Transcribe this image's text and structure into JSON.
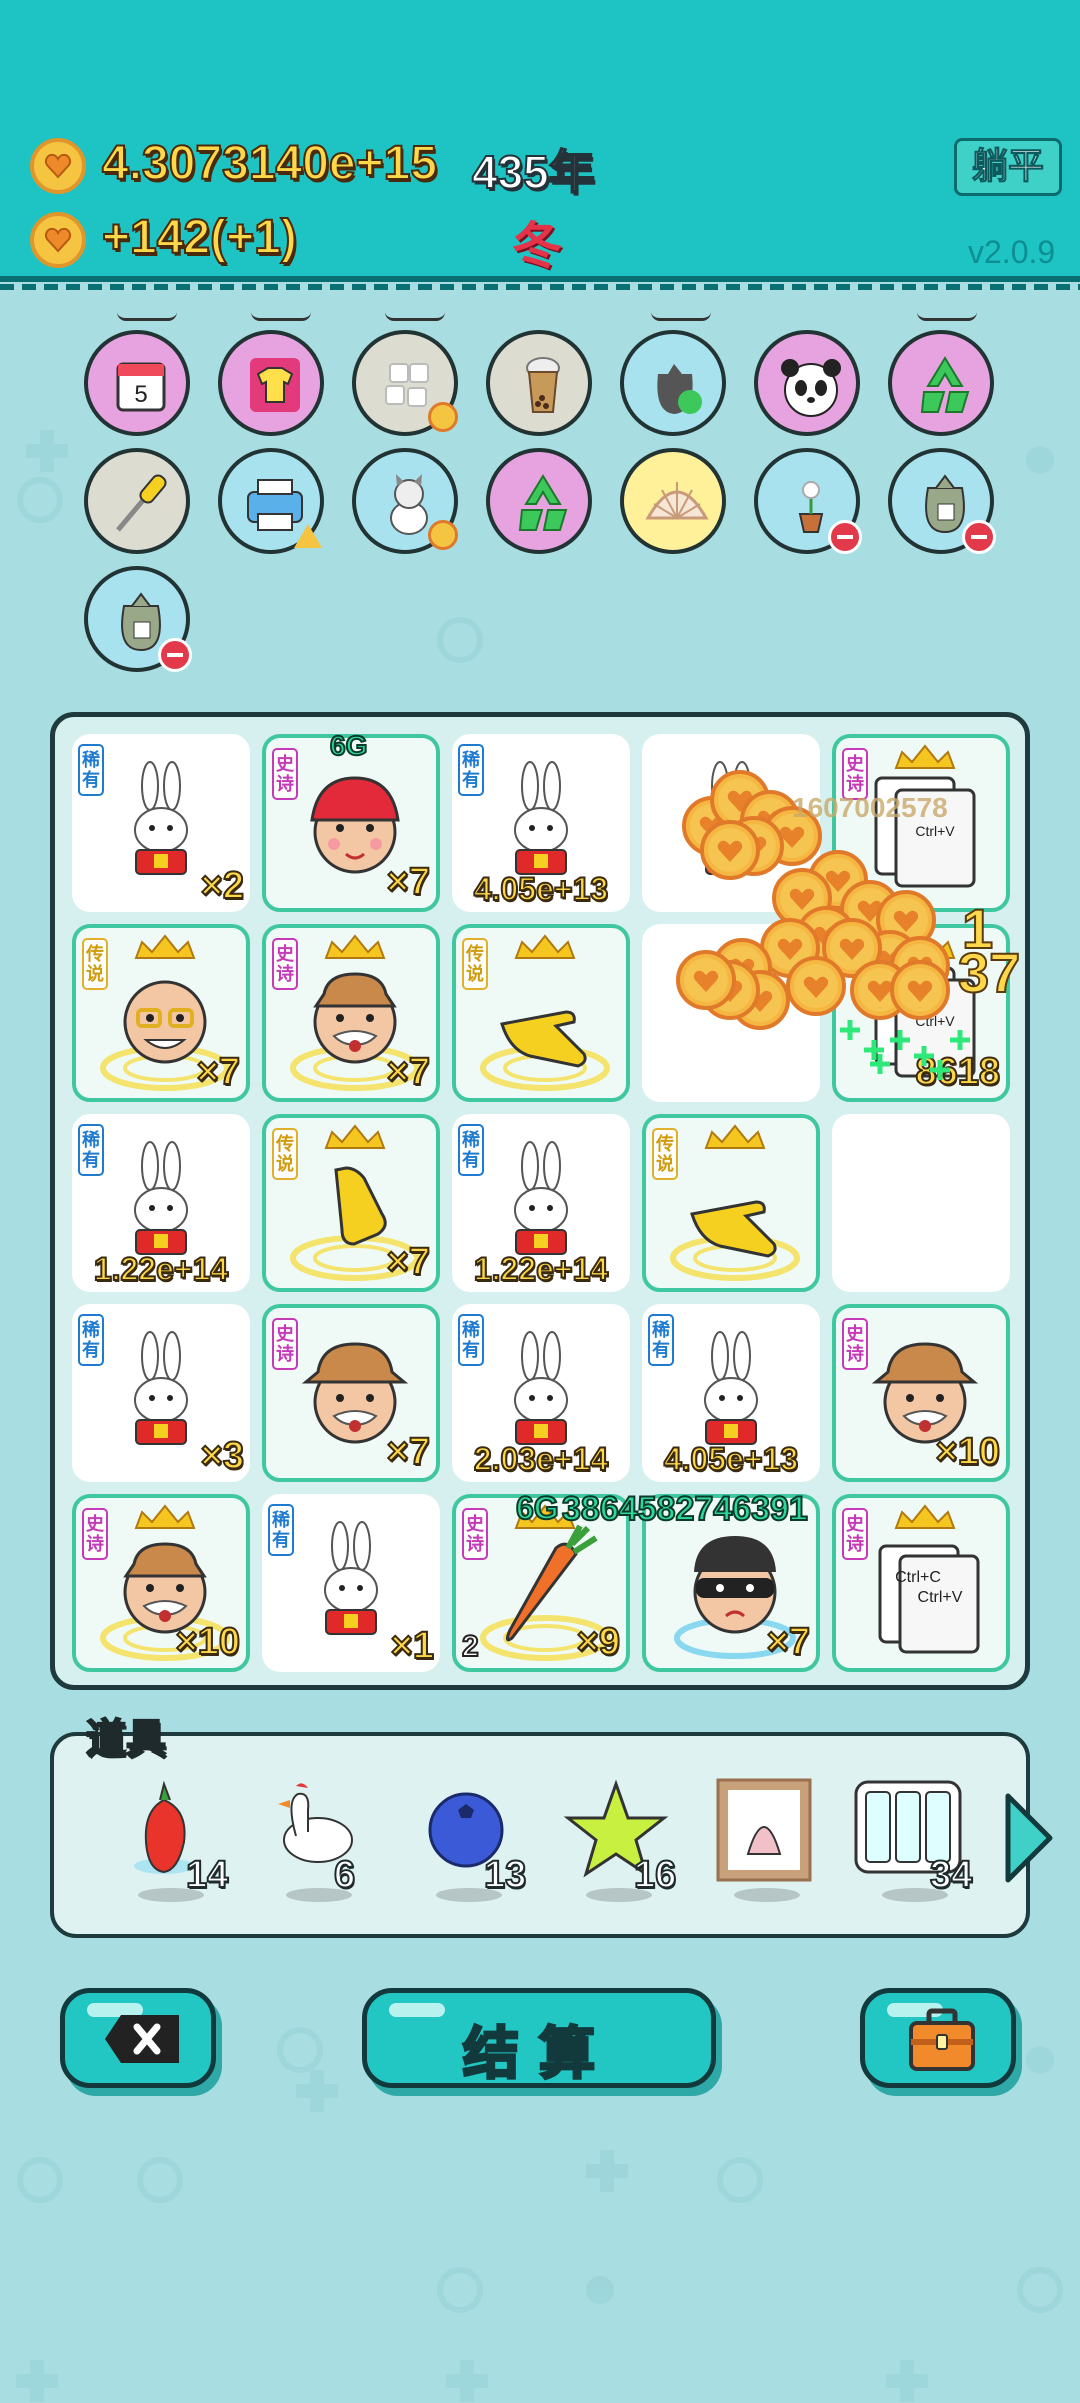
{
  "header": {
    "money": "4.3073140e+15",
    "year": "435年",
    "income": "+142(+1)",
    "season": "冬",
    "lie_flat_label": "躺平",
    "version": "v2.0.9"
  },
  "relics": [
    {
      "name": "calendar",
      "day": "5",
      "bg": "#e6a3e0"
    },
    {
      "name": "tshirt",
      "bg": "#e6a3e0"
    },
    {
      "name": "sugar-cubes",
      "bg": "#dcdcd0"
    },
    {
      "name": "bubble-tea",
      "bg": "#dcdcd0"
    },
    {
      "name": "trash-bag-recycle",
      "bg": "#a9e2ef"
    },
    {
      "name": "panda",
      "bg": "#e6a3e0"
    },
    {
      "name": "recycle",
      "bg": "#e6a3e0"
    },
    {
      "name": "screwdriver",
      "bg": "#dcdcd0"
    },
    {
      "name": "printer",
      "bg": "#a9e2ef"
    },
    {
      "name": "husky",
      "bg": "#a9e2ef"
    },
    {
      "name": "recycle",
      "bg": "#e6a3e0"
    },
    {
      "name": "shell",
      "bg": "#fff199"
    },
    {
      "name": "flower-pot",
      "bg": "#a9e2ef"
    },
    {
      "name": "sack",
      "bg": "#a9e2ef"
    },
    {
      "name": "sack",
      "bg": "#a9e2ef"
    }
  ],
  "board": {
    "cells": [
      {
        "kind": "rabbit",
        "tag": "稀有",
        "value": "×2",
        "green": false
      },
      {
        "kind": "red-cap-boy",
        "tag": "史诗",
        "value": "×7",
        "green": true,
        "top": "6G"
      },
      {
        "kind": "rabbit",
        "tag": "稀有",
        "value": "4.05e+13",
        "green": false
      },
      {
        "kind": "rabbit",
        "tag": "",
        "value": "",
        "green": false
      },
      {
        "kind": "ctrlv",
        "tag": "史诗",
        "value": "",
        "green": true
      },
      {
        "kind": "king-glasses",
        "tag": "传说",
        "value": "×7",
        "green": true
      },
      {
        "kind": "king-farmer",
        "tag": "史诗",
        "value": "×7",
        "green": true
      },
      {
        "kind": "king-hand",
        "tag": "传说",
        "value": "",
        "green": true
      },
      {
        "kind": "empty",
        "tag": "",
        "value": "",
        "green": false
      },
      {
        "kind": "ctrlv",
        "tag": "",
        "value": "8618",
        "green": true
      },
      {
        "kind": "rabbit",
        "tag": "稀有",
        "value": "1.22e+14",
        "green": false
      },
      {
        "kind": "king-hand-down",
        "tag": "传说",
        "value": "×7",
        "green": true
      },
      {
        "kind": "rabbit",
        "tag": "稀有",
        "value": "1.22e+14",
        "green": false
      },
      {
        "kind": "king-hand",
        "tag": "传说",
        "value": "",
        "green": true
      },
      {
        "kind": "empty",
        "tag": "",
        "value": "",
        "green": false
      },
      {
        "kind": "rabbit",
        "tag": "稀有",
        "value": "×3",
        "green": false
      },
      {
        "kind": "farmer",
        "tag": "史诗",
        "value": "×7",
        "green": true
      },
      {
        "kind": "rabbit",
        "tag": "稀有",
        "value": "2.03e+14",
        "green": false
      },
      {
        "kind": "rabbit",
        "tag": "稀有",
        "value": "4.05e+13",
        "green": false
      },
      {
        "kind": "farmer",
        "tag": "史诗",
        "value": "×10",
        "green": true
      },
      {
        "kind": "king-farmer",
        "tag": "史诗",
        "value": "×10",
        "green": true
      },
      {
        "kind": "rabbit",
        "tag": "稀有",
        "value": "×1",
        "green": false
      },
      {
        "kind": "carrot",
        "tag": "史诗",
        "value": "×9",
        "green": true,
        "left": "2"
      },
      {
        "kind": "thief",
        "tag": "",
        "value": "×7",
        "green": true
      },
      {
        "kind": "ctrlcv",
        "tag": "史诗",
        "value": "",
        "green": true
      }
    ],
    "ctrlc_text": "Ctrl+C",
    "ctrlv_text": "Ctrl+V",
    "float_numbers": {
      "coin_trail": "1607002578",
      "burst_1": "1",
      "burst_37": "37",
      "carrot_gain": "6G",
      "carrot_big": "38645827463​91"
    }
  },
  "tools": {
    "title": "道具",
    "items": [
      {
        "name": "chili",
        "count": "14"
      },
      {
        "name": "goose",
        "count": "6"
      },
      {
        "name": "blueberry",
        "count": "13"
      },
      {
        "name": "star",
        "count": "16"
      },
      {
        "name": "framed-picture",
        "count": ""
      },
      {
        "name": "battery-pack",
        "count": "34"
      }
    ]
  },
  "buttons": {
    "settle_label": "结算"
  }
}
